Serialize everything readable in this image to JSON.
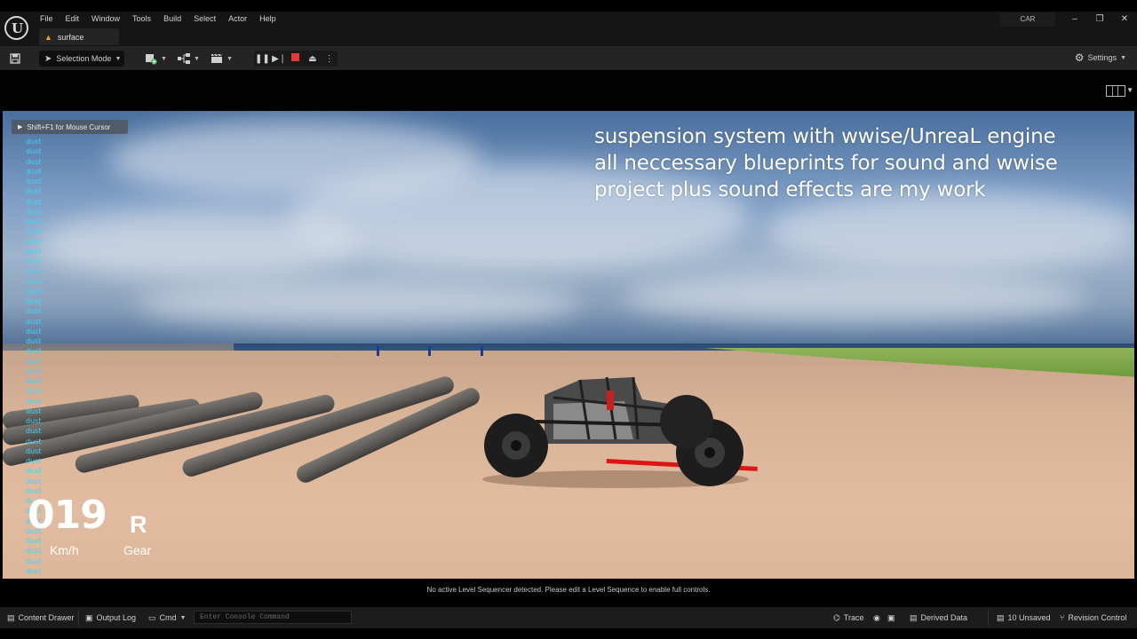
{
  "window": {
    "menus": [
      "File",
      "Edit",
      "Window",
      "Tools",
      "Build",
      "Select",
      "Actor",
      "Help"
    ],
    "level_tab": "surface",
    "project_name": "CAR",
    "minimize": "–",
    "restore": "❐",
    "close": "✕"
  },
  "toolbar": {
    "selection_mode": "Selection Mode",
    "settings": "Settings"
  },
  "viewport": {
    "hint": "Shift+F1 for Mouse Cursor",
    "overlay_lines": [
      "suspension system with wwise/UnreaL engine",
      "all neccessary blueprints for sound and wwise",
      "project plus sound effects are my work"
    ],
    "debug_label": "dust",
    "debug_count": 44,
    "speed_value": "019",
    "speed_unit": "Km/h",
    "gear_value": "R",
    "gear_label": "Gear"
  },
  "sequencer_message": "No active Level Sequencer detected. Please edit a Level Sequence to enable full controls.",
  "statusbar": {
    "content_drawer": "Content Drawer",
    "output_log": "Output Log",
    "cmd": "Cmd",
    "console_placeholder": "Enter Console Command",
    "trace": "Trace",
    "derived_data": "Derived Data",
    "unsaved": "10 Unsaved",
    "revision_control": "Revision Control"
  },
  "colors": {
    "accent_stop": "#e23a3a",
    "debug_text": "#3ad6ff",
    "warning": "#e8a22a"
  }
}
